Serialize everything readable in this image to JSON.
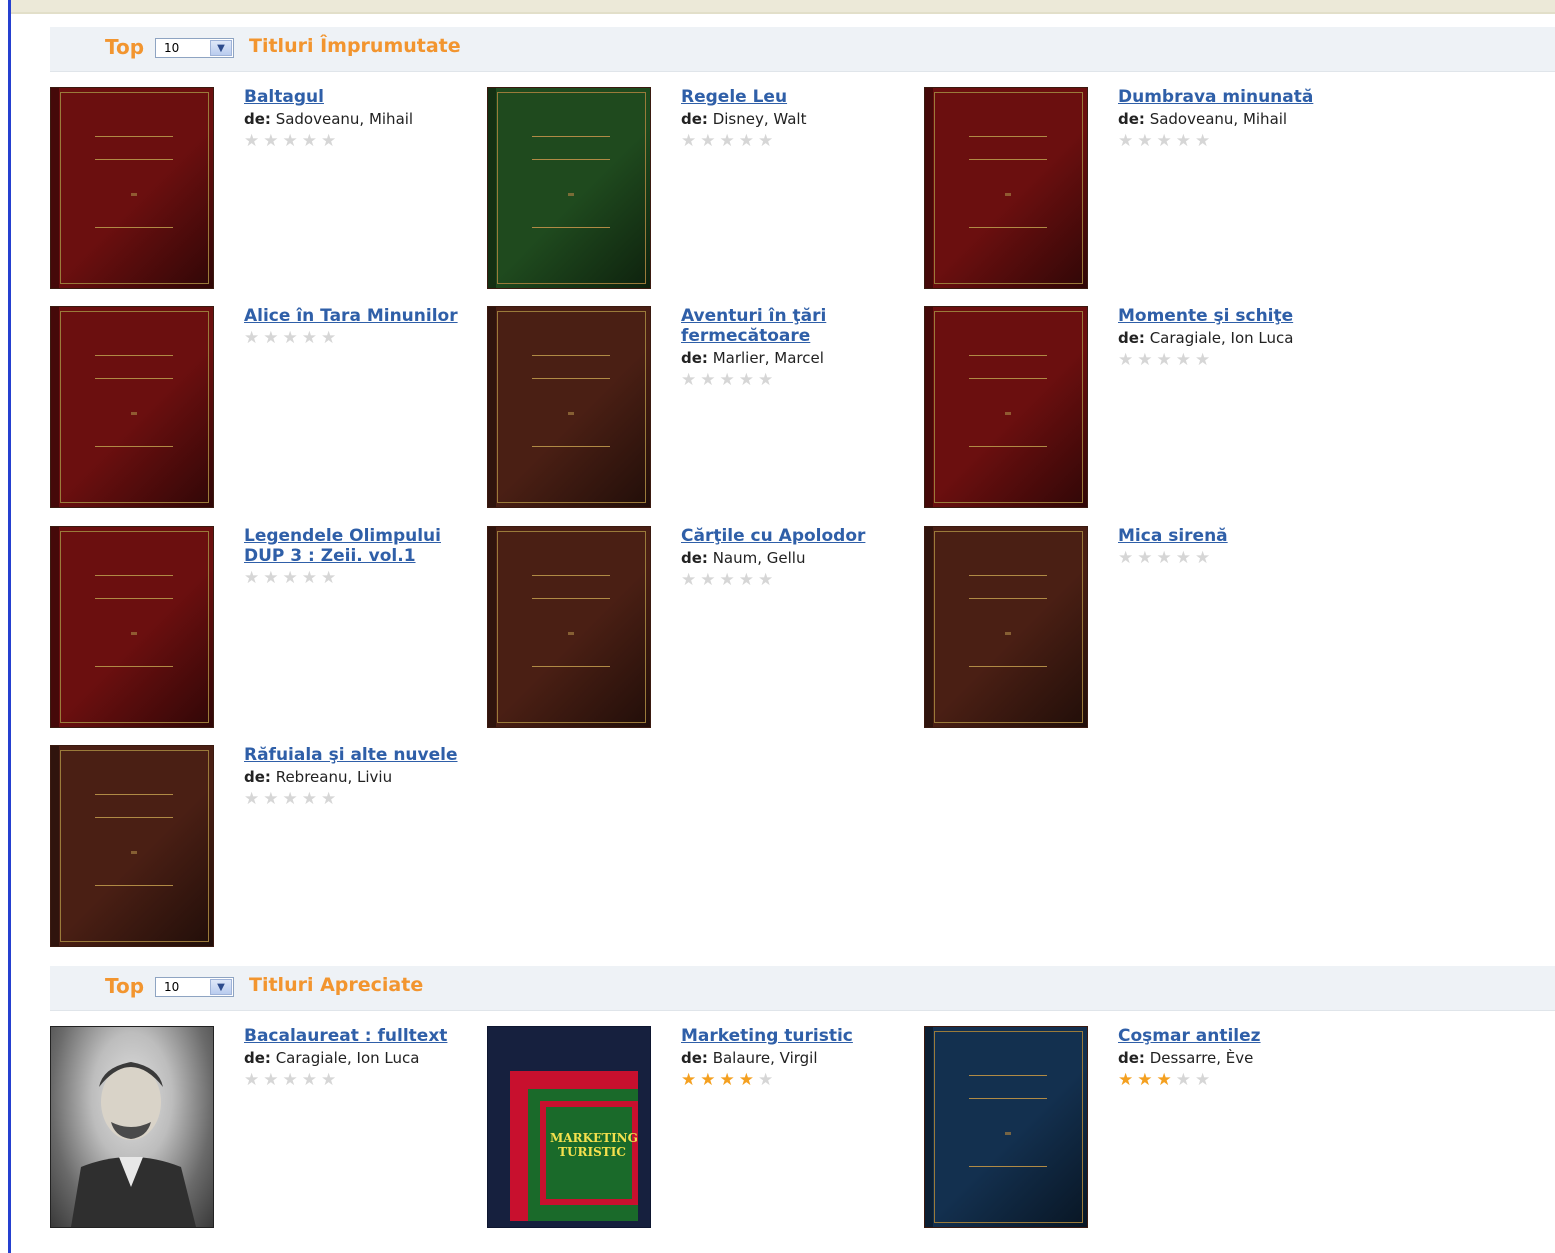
{
  "sections": [
    {
      "top_label": "Top",
      "top_value": "10",
      "title": "Titluri Împrumutate",
      "books": [
        {
          "title": "Baltagul",
          "author_prefix": "de:",
          "author": "Sadoveanu, Mihail",
          "rating": 0,
          "cover_color": "#6b0f0f"
        },
        {
          "title": "Regele Leu",
          "author_prefix": "de:",
          "author": "Disney, Walt",
          "rating": 0,
          "cover_color": "#1f4a1e"
        },
        {
          "title": "Dumbrava minunată",
          "author_prefix": "de:",
          "author": "Sadoveanu, Mihail",
          "rating": 0,
          "cover_color": "#6b0f0f"
        },
        {
          "title": "Alice în Tara Minunilor",
          "author_prefix": "",
          "author": "",
          "rating": 0,
          "cover_color": "#6b0f0f"
        },
        {
          "title": "Aventuri în ţări fermecătoare",
          "author_prefix": "de:",
          "author": "Marlier, Marcel",
          "rating": 0,
          "cover_color": "#4a1f14"
        },
        {
          "title": "Momente şi schiţe",
          "author_prefix": "de:",
          "author": "Caragiale, Ion Luca",
          "rating": 0,
          "cover_color": "#6b0f0f"
        },
        {
          "title": "Legendele Olimpului DUP 3 : Zeii. vol.1",
          "author_prefix": "",
          "author": "",
          "rating": 0,
          "cover_color": "#6b0f0f"
        },
        {
          "title": "Cărţile cu Apolodor",
          "author_prefix": "de:",
          "author": "Naum, Gellu",
          "rating": 0,
          "cover_color": "#4a1f14"
        },
        {
          "title": "Mica sirenă",
          "author_prefix": "",
          "author": "",
          "rating": 0,
          "cover_color": "#4a1f14"
        },
        {
          "title": "Răfuiala şi alte nuvele",
          "author_prefix": "de:",
          "author": "Rebreanu, Liviu",
          "rating": 0,
          "cover_color": "#4a1f14"
        }
      ]
    },
    {
      "top_label": "Top",
      "top_value": "10",
      "title": "Titluri Apreciate",
      "books": [
        {
          "title": "Bacalaureat : fulltext",
          "author_prefix": "de:",
          "author": "Caragiale, Ion Luca",
          "rating": 0,
          "cover_color": "#555555",
          "cover_kind": "portrait"
        },
        {
          "title": "Marketing turistic",
          "author_prefix": "de:",
          "author": "Balaure, Virgil",
          "rating": 4,
          "cover_color": "#1f5a2a",
          "cover_kind": "marketing",
          "cover_text": "MARKETING TURISTIC"
        },
        {
          "title": "Coşmar antilez",
          "author_prefix": "de:",
          "author": "Dessarre, Ève",
          "rating": 3,
          "cover_color": "#13304f"
        }
      ]
    }
  ]
}
